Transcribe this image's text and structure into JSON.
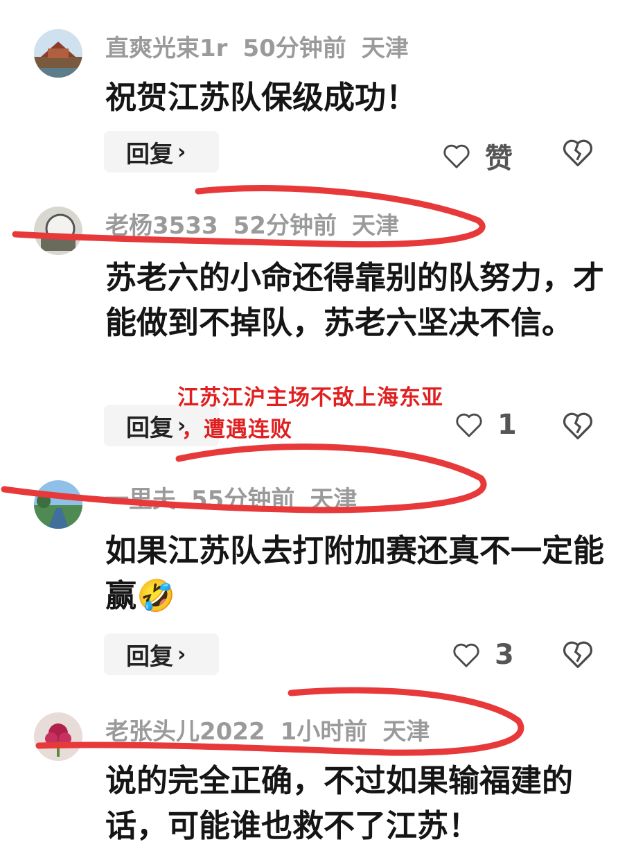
{
  "comments": [
    {
      "username": "直爽光束1r",
      "time": "50分钟前",
      "location": "天津",
      "text": "祝贺江苏队保级成功！",
      "reply_label": "回复",
      "like_label": "赞"
    },
    {
      "username": "老杨3533",
      "time": "52分钟前",
      "location": "天津",
      "text": "苏老六的小命还得靠别的队努力，才能做到不掉队，苏老六坚决不信。",
      "reply_label": "回复",
      "like_label": "1"
    },
    {
      "username": "一里夫",
      "time": "55分钟前",
      "location": "天津",
      "text": "如果江苏队去打附加赛还真不一定能赢",
      "emoji": "🤣",
      "reply_label": "回复",
      "like_label": "3"
    },
    {
      "username": "老张头儿2022",
      "time": "1小时前",
      "location": "天津",
      "text": "说的完全正确，不过如果输福建的话，可能谁也救不了江苏！"
    }
  ],
  "overlay": {
    "line1": "江苏江沪主场不敌上海东亚",
    "line2": "，遭遇连败"
  },
  "icons": {
    "like": "heart-outline-icon",
    "dislike": "broken-heart-icon",
    "reply_arrow": "chevron-right-icon"
  },
  "colors": {
    "scribble": "#e8393a",
    "overlay_text": "#e02020",
    "meta_gray": "#9a9a9a"
  }
}
